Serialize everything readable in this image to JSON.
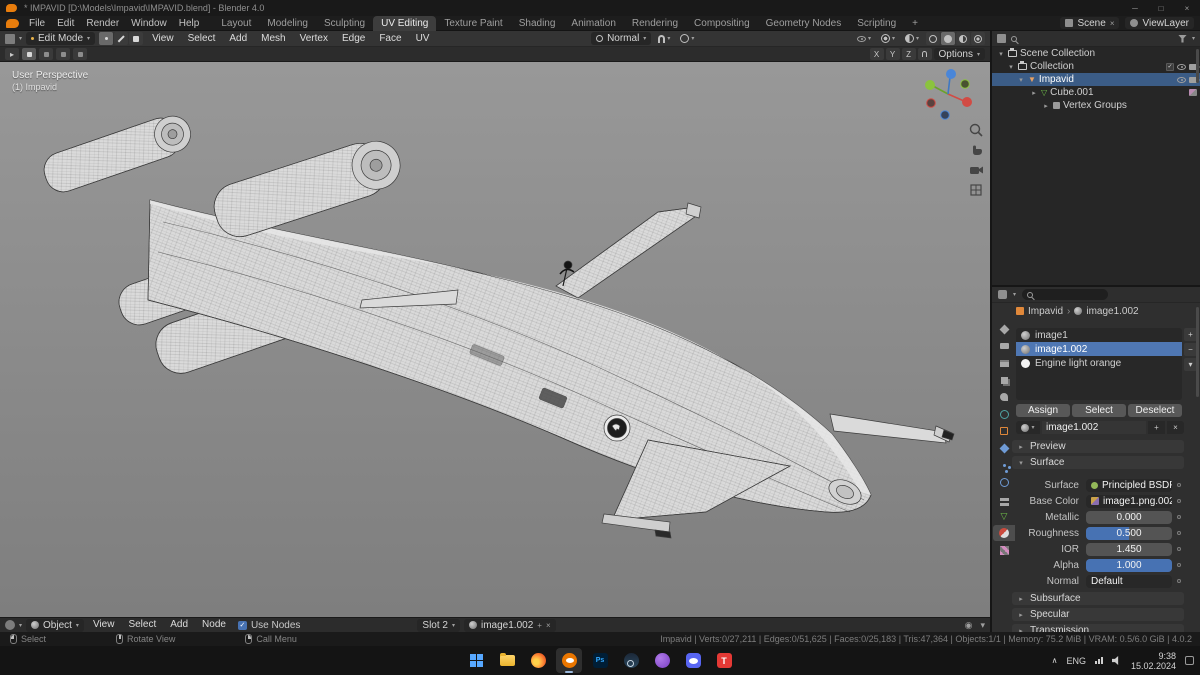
{
  "colors": {
    "accent": "#4772b3",
    "selection-outliner": "#3b5c86",
    "selection-slot": "#4f77b3",
    "header-bg": "#343434",
    "panel-bg": "#2f2f2f",
    "viewport-top": "#989898",
    "viewport-bottom": "#7e7e7e",
    "blender-orange": "#e87d0d"
  },
  "title_bar": {
    "title": "* IMPAVID [D:\\Models\\Impavid\\IMPAVID.blend] - Blender 4.0"
  },
  "top_bar": {
    "menus": [
      "File",
      "Edit",
      "Render",
      "Window",
      "Help"
    ],
    "workspaces": [
      "Layout",
      "Modeling",
      "Sculpting",
      "UV Editing",
      "Texture Paint",
      "Shading",
      "Animation",
      "Rendering",
      "Compositing",
      "Geometry Nodes",
      "Scripting"
    ],
    "active_workspace": "UV Editing",
    "add_workspace": "+",
    "scene": "Scene",
    "view_layer": "ViewLayer"
  },
  "viewport_header": {
    "mode": "Edit Mode",
    "menus": [
      "View",
      "Select",
      "Add",
      "Mesh",
      "Vertex",
      "Edge",
      "Face",
      "UV"
    ],
    "orientation": "Normal",
    "axis_toggles": [
      "X",
      "Y",
      "Z"
    ],
    "options": "Options"
  },
  "viewport": {
    "perspective_label": "User Perspective",
    "object_label": "(1) Impavid"
  },
  "outliner": {
    "items": [
      {
        "label": "Scene Collection"
      },
      {
        "label": "Collection"
      },
      {
        "label": "Impavid"
      },
      {
        "label": "Cube.001"
      },
      {
        "label": "Vertex Groups"
      }
    ]
  },
  "properties": {
    "breadcrumb": [
      "Impavid",
      "image1.002"
    ],
    "slots": [
      "image1",
      "image1.002",
      "Engine light orange"
    ],
    "active_slot": "image1.002",
    "assign": "Assign",
    "select": "Select",
    "deselect": "Deselect",
    "material_name": "image1.002",
    "panels": {
      "preview": "Preview",
      "surface": "Surface",
      "subsurface": "Subsurface",
      "specular": "Specular",
      "transmission": "Transmission"
    },
    "surface_rows": [
      {
        "label": "Surface",
        "value": "Principled BSDF"
      },
      {
        "label": "Base Color",
        "value": "image1.png.002"
      },
      {
        "label": "Metallic",
        "value": "0.000"
      },
      {
        "label": "Roughness",
        "value": "0.500"
      },
      {
        "label": "IOR",
        "value": "1.450"
      },
      {
        "label": "Alpha",
        "value": "1.000"
      },
      {
        "label": "Normal",
        "value": "Default"
      }
    ]
  },
  "shader_editor": {
    "type": "Object",
    "menus": [
      "View",
      "Select",
      "Add",
      "Node"
    ],
    "use_nodes": "Use Nodes",
    "slot": "Slot 2",
    "image": "image1.002"
  },
  "status_bar": {
    "hints": [
      {
        "button": "left",
        "label": "Select"
      },
      {
        "button": "middle",
        "label": "Rotate View"
      },
      {
        "button": "right",
        "label": "Call Menu"
      }
    ],
    "stats": "Impavid | Verts:0/27,211 | Edges:0/51,625 | Faces:0/25,183 | Tris:47,364 | Objects:1/1 | Memory: 75.2 MiB | VRAM: 0.5/6.0 GiB | 4.0.2"
  },
  "taskbar": {
    "apps": [
      "start",
      "explorer",
      "firefox",
      "blender",
      "photoshop",
      "steam",
      "media-app",
      "discord",
      "teamviewer"
    ],
    "language": "ENG",
    "time": "9:38",
    "date": "15.02.2024"
  }
}
